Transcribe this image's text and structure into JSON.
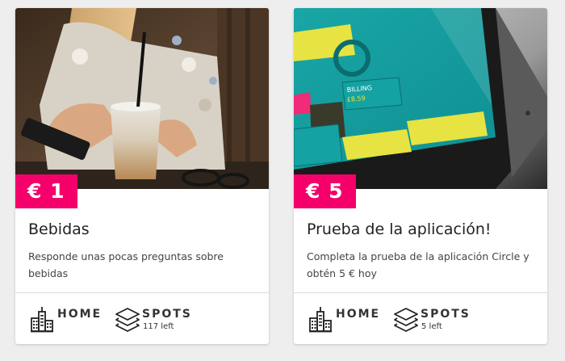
{
  "colors": {
    "background": "#eeeeee",
    "card": "#ffffff",
    "price_badge": "#f5006a",
    "text_dark": "#222222"
  },
  "cards": [
    {
      "image": "woman-with-drink-and-phone-photo",
      "price": "€ 1",
      "title": "Bebidas",
      "description": "Responde unas pocas preguntas sobre bebidas",
      "footer": {
        "home_icon": "city-buildings-icon",
        "home_label": "HOME",
        "spots_icon": "layers-stack-icon",
        "spots_label": "SPOTS",
        "spots_left": "117 left"
      }
    },
    {
      "image": "smartphone-app-photo",
      "price": "€ 5",
      "title": "Prueba de la aplicación!",
      "description": "Completa la prueba de la aplicación Circle y obtén 5 € hoy",
      "footer": {
        "home_icon": "city-buildings-icon",
        "home_label": "HOME",
        "spots_icon": "layers-stack-icon",
        "spots_label": "SPOTS",
        "spots_left": "5 left"
      }
    }
  ]
}
